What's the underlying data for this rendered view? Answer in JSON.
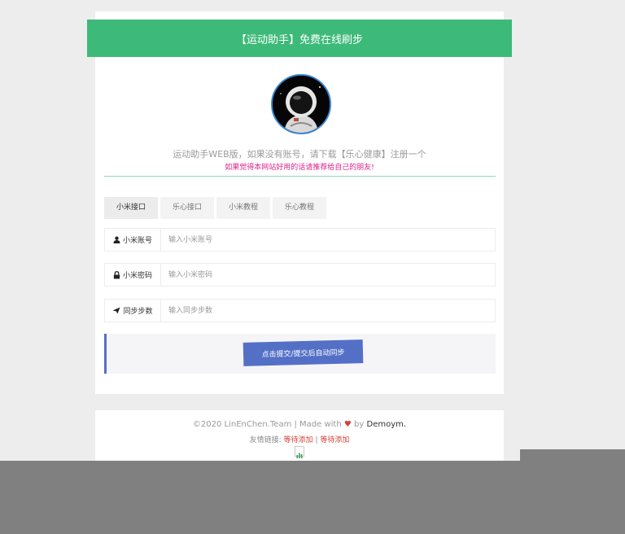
{
  "header": {
    "title": "【运动助手】免费在线刷步"
  },
  "intro": {
    "subtitle": "运动助手WEB版，如果没有账号，请下载【乐心健康】注册一个",
    "notice": "如果觉得本网站好用的话请推荐给自己的朋友!"
  },
  "tabs": [
    {
      "label": "小米接口",
      "active": true
    },
    {
      "label": "乐心接口",
      "active": false
    },
    {
      "label": "小米教程",
      "active": false
    },
    {
      "label": "乐心教程",
      "active": false
    }
  ],
  "form": {
    "account": {
      "label": "小米账号",
      "placeholder": "输入小米账号",
      "icon": "user-icon"
    },
    "password": {
      "label": "小米密码",
      "placeholder": "输入小米密码",
      "icon": "lock-icon"
    },
    "steps": {
      "label": "同步步数",
      "placeholder": "输入同步步数",
      "icon": "send-icon"
    },
    "submit_label": "点击提交/提交后自动同步"
  },
  "footer": {
    "copyright_prefix": "©2020 LinEnChen.Team | Made with",
    "heart": "♥",
    "by": "by",
    "author": "Demoym",
    "period": ".",
    "links_label": "友情链接:",
    "link1": "等待添加",
    "separator": "|",
    "link2": "等待添加"
  },
  "colors": {
    "banner": "#3dba79",
    "accent": "#5470c6",
    "notice": "#e0218a",
    "link": "#d43f3a"
  }
}
